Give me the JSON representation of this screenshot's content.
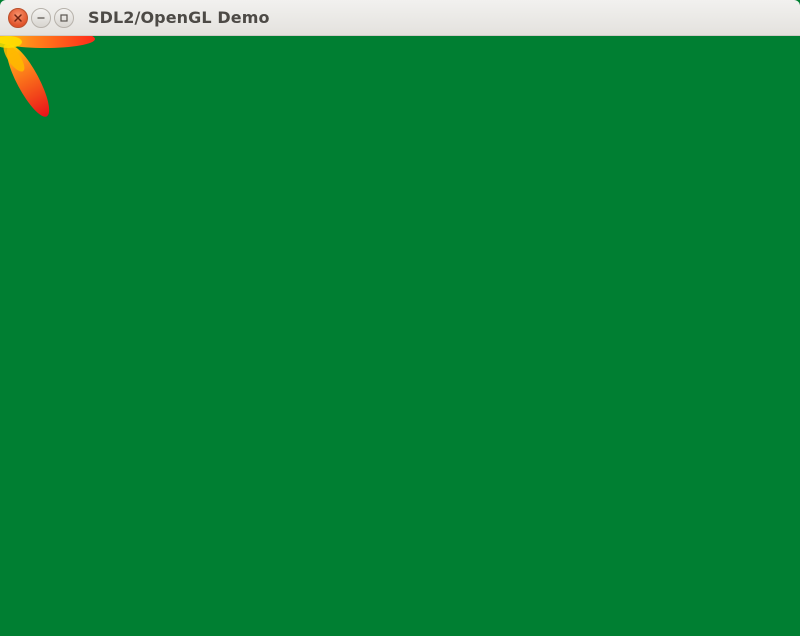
{
  "window": {
    "title": "SDL2/OpenGL Demo",
    "controls": {
      "close": "close-icon",
      "minimize": "minimize-icon",
      "maximize": "maximize-icon"
    }
  },
  "canvas": {
    "background_color": "#007f32",
    "shape_colors": [
      "#ff2a1a",
      "#ff8a1a",
      "#ffd400"
    ]
  }
}
